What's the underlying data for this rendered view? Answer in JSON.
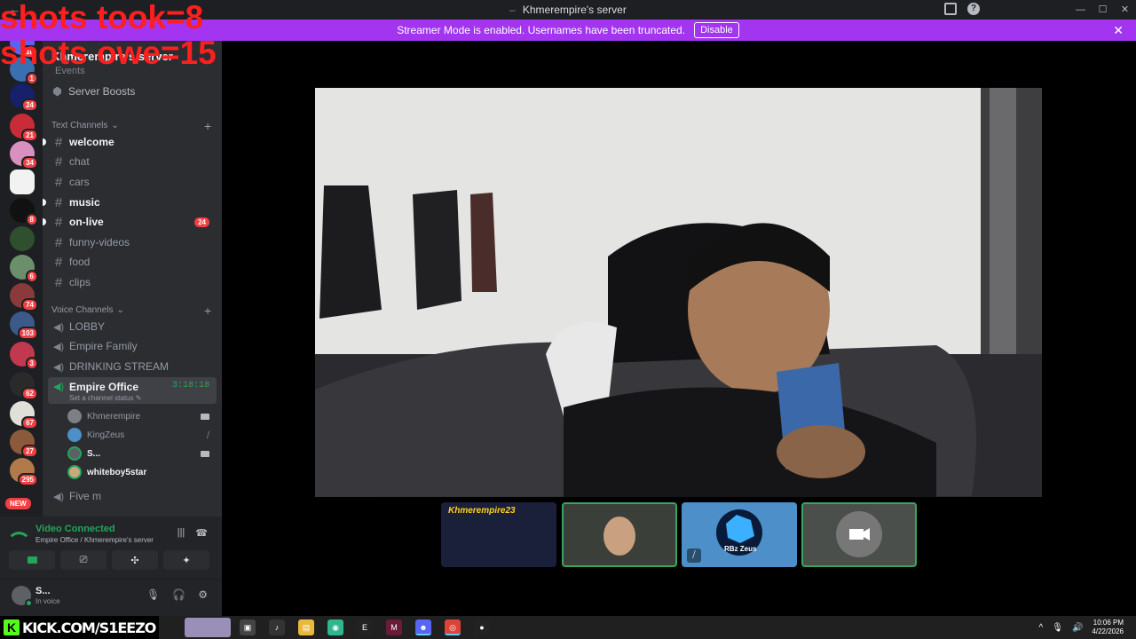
{
  "overlay": {
    "line1": "shots took=8",
    "line2": "shots owe=15"
  },
  "window": {
    "title": "Khmerempire's server",
    "controls": [
      "—",
      "☐",
      "✕"
    ]
  },
  "banner": {
    "message": "Streamer Mode is enabled. Usernames have been truncated.",
    "button": "Disable",
    "accent": "#a334ef"
  },
  "rail": {
    "badges": [
      "16",
      "1",
      "24",
      "21",
      "34",
      "8",
      "6",
      "74",
      "103",
      "3",
      "62",
      "67",
      "27",
      "295"
    ],
    "new_label": "NEW"
  },
  "sidebar": {
    "server_name": "Khmerempire's server",
    "events": "Events",
    "server_boosts": "Server Boosts",
    "text_category": "Text Channels",
    "text_channels": [
      {
        "name": "welcome",
        "unread": true,
        "count": ""
      },
      {
        "name": "chat",
        "unread": false,
        "count": ""
      },
      {
        "name": "cars",
        "unread": false,
        "count": ""
      },
      {
        "name": "music",
        "unread": true,
        "count": ""
      },
      {
        "name": "on-live",
        "unread": true,
        "count": "24"
      },
      {
        "name": "funny-videos",
        "unread": false,
        "count": ""
      },
      {
        "name": "food",
        "unread": false,
        "count": ""
      },
      {
        "name": "clips",
        "unread": false,
        "count": ""
      }
    ],
    "voice_category": "Voice Channels",
    "voice_channels": [
      {
        "name": "LOBBY"
      },
      {
        "name": "Empire Family"
      },
      {
        "name": "DRINKING STREAM"
      },
      {
        "name": "Empire Office",
        "timer": "3:18:18",
        "status": "Set a channel status"
      },
      {
        "name": "Five m"
      }
    ],
    "members": [
      {
        "name": "Khmerempire",
        "icon": "camera"
      },
      {
        "name": "KingZeus",
        "icon": "mic-muted"
      },
      {
        "name": "S...",
        "icon": "camera"
      },
      {
        "name": "whiteboy5star",
        "icon": ""
      }
    ]
  },
  "voice_panel": {
    "status": "Video Connected",
    "location": "Empire Office / Khmerempire's server"
  },
  "user_panel": {
    "name": "S...",
    "state": "In voice"
  },
  "tiles": {
    "t1_label": "Khmerempire23",
    "t3_label": "RBz Zeus"
  },
  "taskbar": {
    "stream_url": "KICK.COM/S1EEZO",
    "time": "10:06 PM",
    "date": "4/22/2026"
  },
  "colors": {
    "green": "#23a55a",
    "red": "#f23f43",
    "kick_green": "#53fc18"
  }
}
